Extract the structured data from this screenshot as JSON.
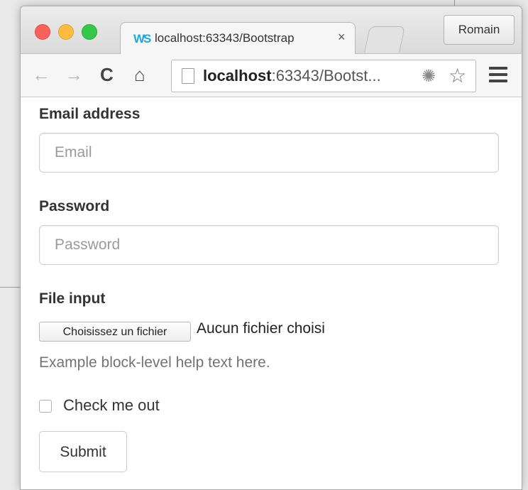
{
  "browser": {
    "tab_title": "localhost:63343/Bootstrap",
    "tab_close": "×",
    "profile_name": "Romain",
    "url_host": "localhost",
    "url_rest": ":63343/Bootst...",
    "icons": {
      "back": "back-arrow-icon",
      "forward": "forward-arrow-icon",
      "reload": "reload-icon",
      "home": "home-icon",
      "page": "page-icon",
      "extension": "extension-icon",
      "bookmark": "star-icon",
      "menu": "hamburger-menu-icon"
    }
  },
  "form": {
    "email_label": "Email address",
    "email_placeholder": "Email",
    "password_label": "Password",
    "password_placeholder": "Password",
    "file_label": "File input",
    "file_button": "Choisissez un fichier",
    "file_status": "Aucun fichier choisi",
    "help_text": "Example block-level help text here.",
    "checkbox_label": "Check me out",
    "submit_label": "Submit"
  }
}
